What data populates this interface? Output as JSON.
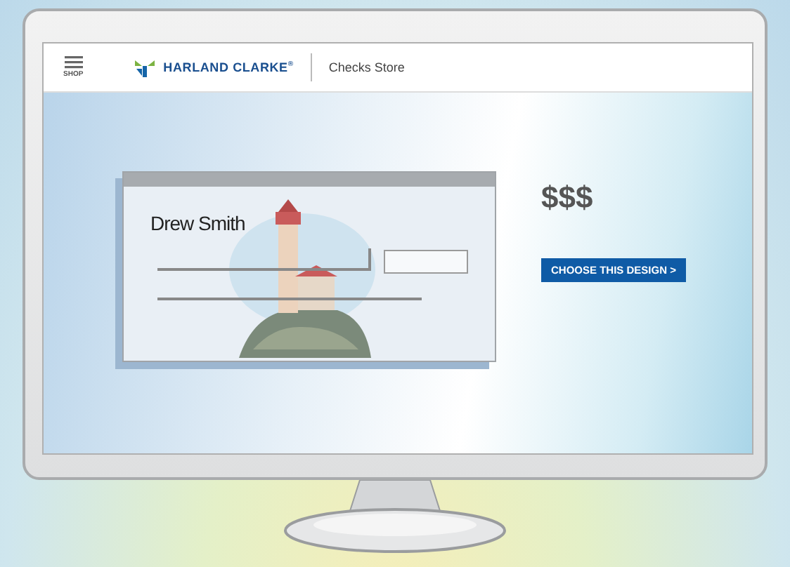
{
  "header": {
    "menu_label": "SHOP",
    "brand": "HARLAND CLARKE$^{®}$",
    "store": "Checks Store"
  },
  "check": {
    "name": "Drew Smith"
  },
  "price": "$$$",
  "button": "CHOOSE THIS DESIGN >"
}
